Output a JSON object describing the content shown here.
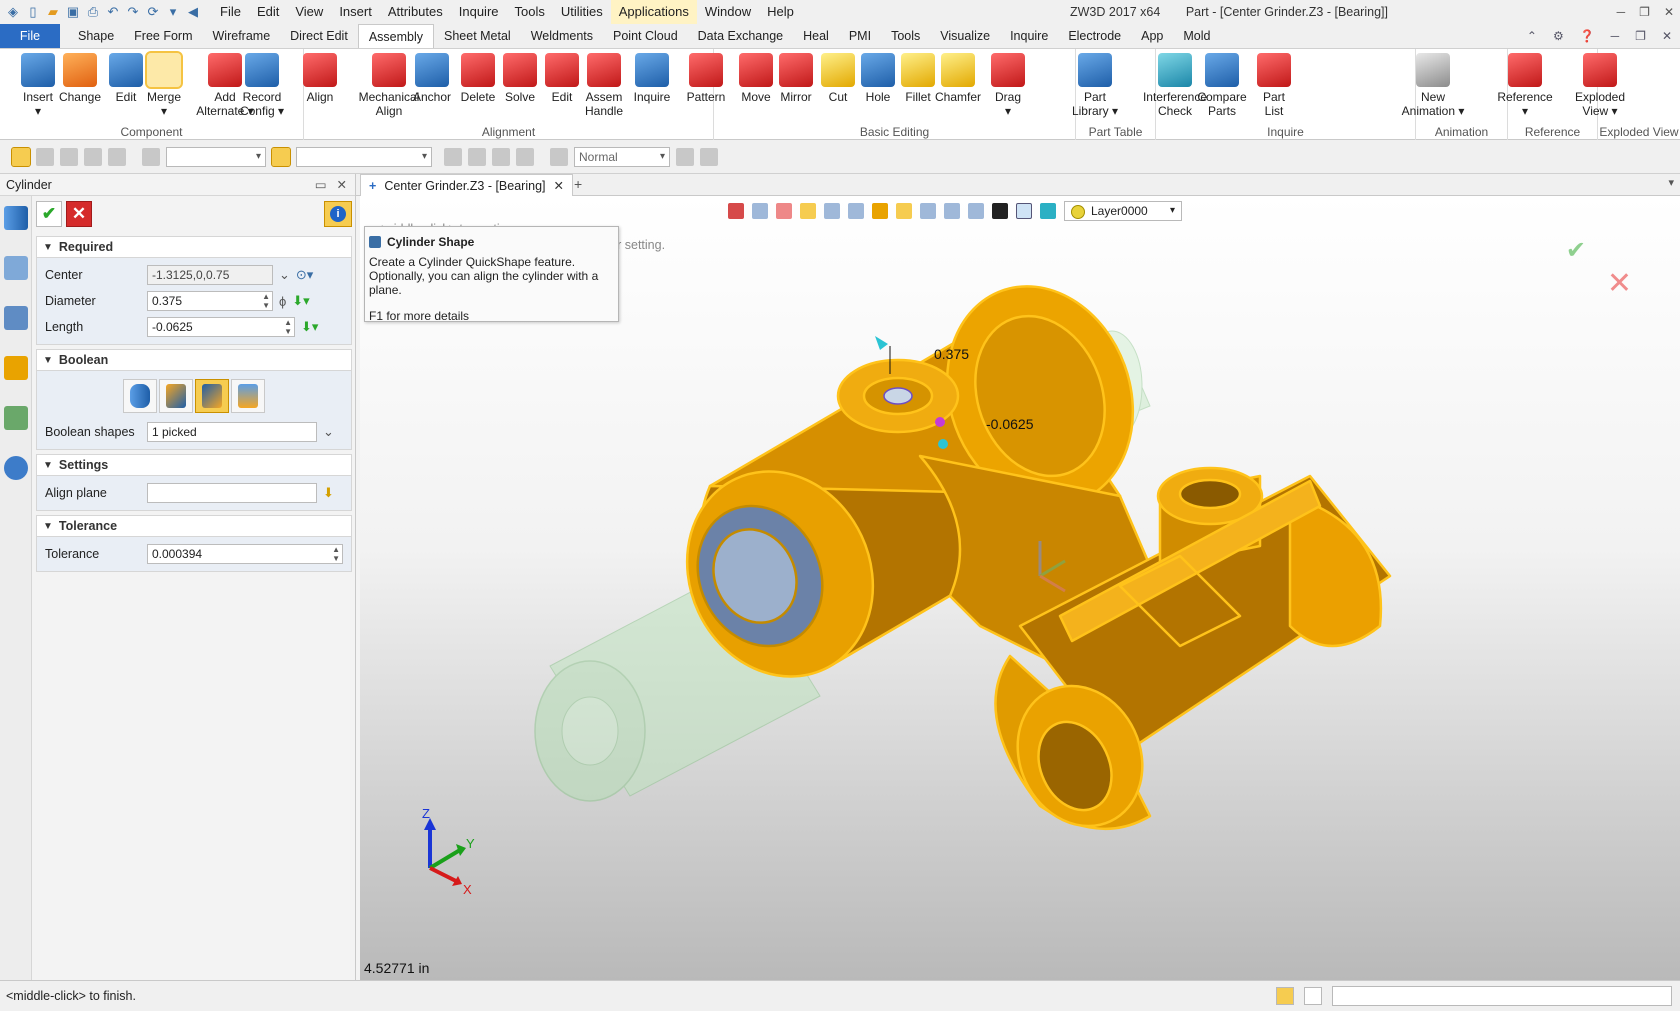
{
  "titlebar": {
    "app_version": "ZW3D 2017  x64",
    "document": "Part - [Center Grinder.Z3 - [Bearing]]",
    "menu": [
      "File",
      "Edit",
      "View",
      "Insert",
      "Attributes",
      "Inquire",
      "Tools",
      "Utilities",
      "Applications",
      "Window",
      "Help"
    ],
    "highlighted_menu": "Applications"
  },
  "ribbon_tabs": [
    "File",
    "Shape",
    "Free Form",
    "Wireframe",
    "Direct Edit",
    "Assembly",
    "Sheet Metal",
    "Weldments",
    "Point Cloud",
    "Data Exchange",
    "Heal",
    "PMI",
    "Tools",
    "Visualize",
    "Inquire",
    "Electrode",
    "App",
    "Mold"
  ],
  "active_tab": "Assembly",
  "ribbon": {
    "component": {
      "label": "Component",
      "buttons": [
        {
          "line1": "Insert",
          "line2": "▾"
        },
        {
          "line1": "Change",
          "line2": ""
        },
        {
          "line1": "Edit",
          "line2": ""
        },
        {
          "line1": "Merge",
          "line2": "▾"
        },
        {
          "line1": "Add",
          "line2": "Alternate ▾"
        },
        {
          "line1": "Record",
          "line2": "Config ▾"
        }
      ]
    },
    "alignment": {
      "label": "Alignment",
      "buttons": [
        {
          "line1": "Align",
          "line2": ""
        },
        {
          "line1": "Mechanical",
          "line2": "Align"
        },
        {
          "line1": "Anchor",
          "line2": ""
        },
        {
          "line1": "Delete",
          "line2": ""
        },
        {
          "line1": "Solve",
          "line2": ""
        },
        {
          "line1": "Edit",
          "line2": ""
        },
        {
          "line1": "Assem",
          "line2": "Handle"
        },
        {
          "line1": "Inquire",
          "line2": ""
        }
      ]
    },
    "basic_editing": {
      "label": "Basic Editing",
      "buttons": [
        {
          "line1": "Pattern",
          "line2": ""
        },
        {
          "line1": "Move",
          "line2": ""
        },
        {
          "line1": "Mirror",
          "line2": ""
        },
        {
          "line1": "Cut",
          "line2": ""
        },
        {
          "line1": "Hole",
          "line2": ""
        },
        {
          "line1": "Fillet",
          "line2": ""
        },
        {
          "line1": "Chamfer",
          "line2": ""
        },
        {
          "line1": "Drag",
          "line2": "▾"
        }
      ]
    },
    "part_table": {
      "label": "Part Table",
      "buttons": [
        {
          "line1": "Part",
          "line2": "Library ▾"
        }
      ]
    },
    "inquire": {
      "label": "Inquire",
      "buttons": [
        {
          "line1": "Interference",
          "line2": "Check"
        },
        {
          "line1": "Compare",
          "line2": "Parts"
        },
        {
          "line1": "Part",
          "line2": "List"
        }
      ]
    },
    "animation": {
      "label": "Animation",
      "buttons": [
        {
          "line1": "New",
          "line2": "Animation ▾"
        }
      ]
    },
    "reference": {
      "label": "Reference",
      "buttons": [
        {
          "line1": "Reference",
          "line2": "▾"
        }
      ]
    },
    "exploded_view": {
      "label": "Exploded View",
      "buttons": [
        {
          "line1": "Exploded",
          "line2": "View ▾"
        }
      ]
    }
  },
  "toolbar2": {
    "display_mode": "Normal"
  },
  "panel": {
    "title": "Cylinder",
    "required": {
      "header": "Required",
      "center_label": "Center",
      "center_value": "-1.3125,0,0.75",
      "diameter_label": "Diameter",
      "diameter_value": "0.375",
      "length_label": "Length",
      "length_value": "-0.0625"
    },
    "boolean": {
      "header": "Boolean",
      "shapes_label": "Boolean shapes",
      "shapes_value": "1 picked"
    },
    "settings": {
      "header": "Settings",
      "align_plane_label": "Align plane",
      "align_plane_value": ""
    },
    "tolerance": {
      "header": "Tolerance",
      "tolerance_label": "Tolerance",
      "tolerance_value": "0.000394"
    }
  },
  "document_tab": {
    "label": "Center Grinder.Z3 - [Bearing]"
  },
  "viewport": {
    "layer": "Layer0000",
    "prompt_line1": "<middle-click> to continue.",
    "prompt_line2": "<Ctrl>+<Shift>+<Scroll> to find next cylinder setting.",
    "tooltip_title": "Cylinder Shape",
    "tooltip_body": "Create a Cylinder QuickShape feature.  Optionally, you can align the cylinder with a plane.",
    "tooltip_help": "F1 for more details",
    "dim_diameter": "0.375",
    "dim_length": "-0.0625",
    "distance_readout": "4.52771 in",
    "axes": {
      "x": "X",
      "y": "Y",
      "z": "Z"
    }
  },
  "statusbar": {
    "message": "<middle-click> to finish."
  },
  "colors": {
    "accent": "#2b6cc4",
    "highlight": "#f6cc50",
    "part_fill": "#eba000",
    "part_edge": "#ffc31a"
  }
}
